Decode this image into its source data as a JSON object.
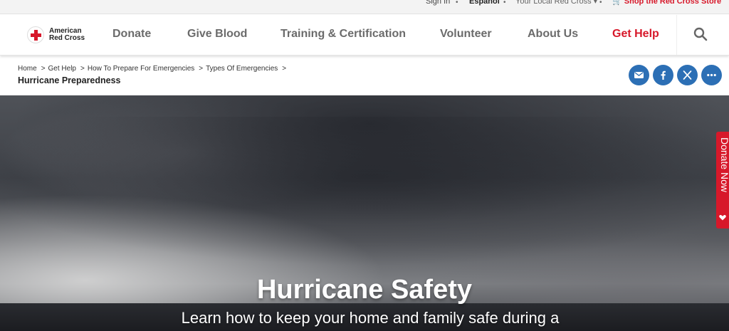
{
  "utility": {
    "sign_in": "Sign In",
    "espanol": "Español",
    "local": "Your Local Red Cross",
    "shop": "Shop the Red Cross Store"
  },
  "logo": {
    "line1": "American",
    "line2": "Red Cross"
  },
  "nav": {
    "donate": "Donate",
    "give_blood": "Give Blood",
    "training": "Training & Certification",
    "volunteer": "Volunteer",
    "about": "About Us",
    "get_help": "Get Help"
  },
  "breadcrumb": {
    "items": [
      "Home",
      "Get Help",
      "How To Prepare For Emergencies",
      "Types Of Emergencies"
    ],
    "separator": ">",
    "current": "Hurricane Preparedness"
  },
  "share": {
    "icons": [
      "email-icon",
      "facebook-icon",
      "x-icon",
      "more-icon"
    ]
  },
  "hero": {
    "title": "Hurricane Safety",
    "subtitle": "Learn how to keep your home and family safe during a"
  },
  "donate_tab": {
    "label": "Donate Now"
  },
  "colors": {
    "brand_red": "#d7182a",
    "share_blue": "#2c6fb5"
  }
}
